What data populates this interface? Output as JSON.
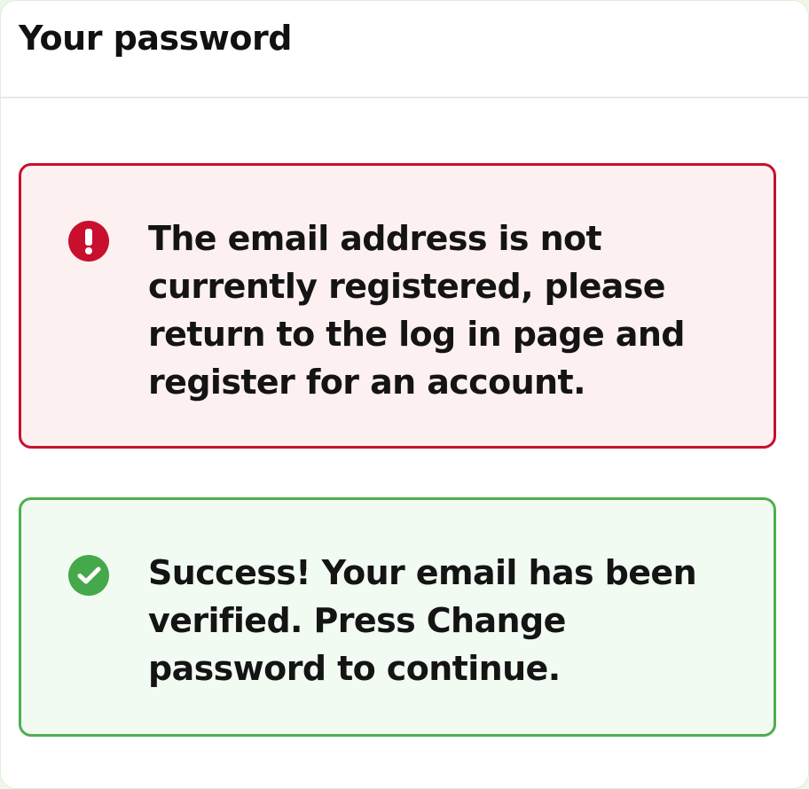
{
  "header": {
    "title": "Your password"
  },
  "alerts": {
    "error": {
      "icon": "exclamation-circle-icon",
      "color": "#c8102e",
      "message": "The email address is not currently registered, please return to the log in page and register for an account."
    },
    "success": {
      "icon": "check-circle-icon",
      "color": "#4caf50",
      "message": "Success! Your email has been verified. Press Change password to continue."
    }
  }
}
